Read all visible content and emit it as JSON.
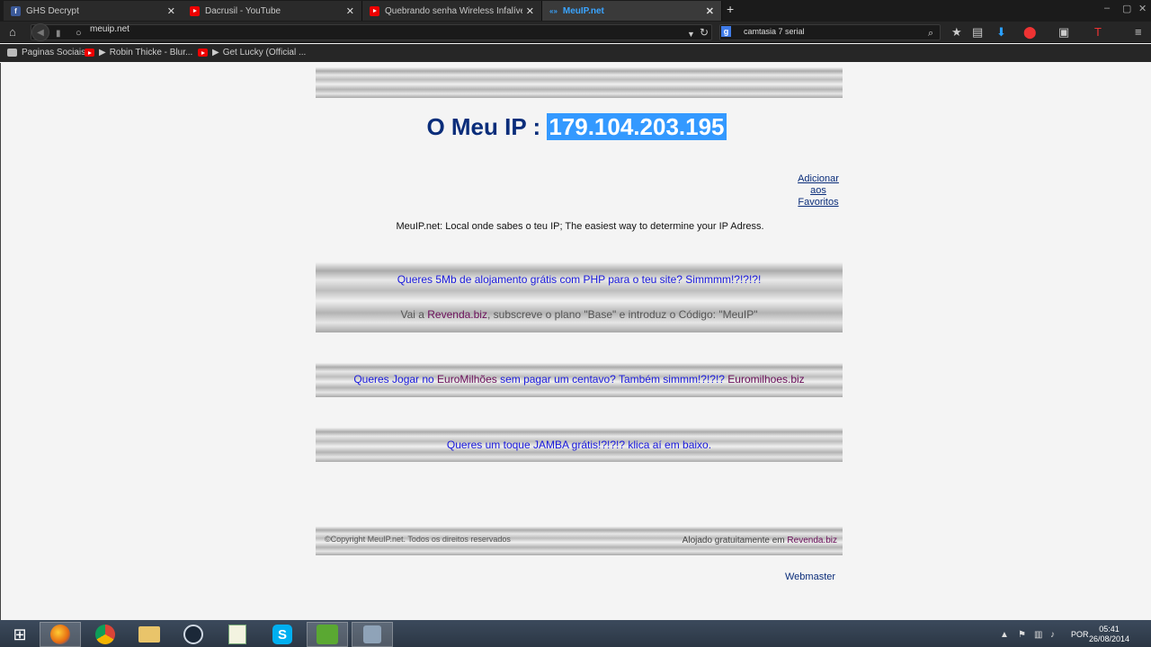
{
  "browser": {
    "tabs": [
      {
        "title": "GHS Decrypt",
        "icon": "facebook-icon",
        "active": false
      },
      {
        "title": "Dacrusil - YouTube",
        "icon": "youtube-icon",
        "active": false
      },
      {
        "title": "Quebrando senha Wireless Infalível ...",
        "icon": "youtube-icon",
        "active": false
      },
      {
        "title": "MeuIP.net",
        "icon": "page-icon",
        "active": true
      }
    ],
    "new_tab": "+",
    "url": "meuip.net",
    "search_text": "camtasia 7 serial",
    "search_engine_icon": "google-icon",
    "bookmarks": [
      {
        "label": "Paginas Sociais",
        "icon": "folder-icon"
      },
      {
        "label": "Robin Thicke - Blur...",
        "icon": "youtube-icon"
      },
      {
        "label": "Get Lucky (Official ...",
        "icon": "youtube-icon"
      }
    ]
  },
  "page": {
    "title_prefix": "O Meu IP : ",
    "ip_address": "179.104.203.195",
    "favorites_link": "Adicionar aos Favoritos",
    "tagline": "MeuIP.net: Local onde sabes o teu IP; The easiest way to determine your IP Adress.",
    "promo1": {
      "line1": "Queres 5Mb de alojamento grátis com PHP para o teu site? Simmmm!?!?!?!",
      "line2_prefix": "Vai a ",
      "line2_link": "Revenda.biz",
      "line2_suffix": ", subscreve o plano \"Base\" e introduz o Código: \"MeuIP\""
    },
    "promo2": {
      "prefix": "Queres Jogar no ",
      "link1": "EuroMilhões",
      "middle": " sem pagar um centavo? Também simmm!?!?!? ",
      "link2": "Euromilhoes.biz"
    },
    "promo3": "Queres um toque JAMBA grátis!?!?!? klica aí em baixo.",
    "footer": {
      "copyright": "©Copyright MeuIP.net. Todos os direitos reservados",
      "hosted_prefix": "Alojado gratuitamente em ",
      "hosted_link": "Revenda.biz"
    },
    "webmaster": "Webmaster"
  },
  "taskbar": {
    "lang": "POR",
    "time": "05:41",
    "date": "26/08/2014"
  },
  "colors": {
    "title_blue": "#0a2d7a",
    "link_blue": "#1a1adc",
    "visited_purple": "#6b0f5a",
    "selection": "#3399ff"
  }
}
